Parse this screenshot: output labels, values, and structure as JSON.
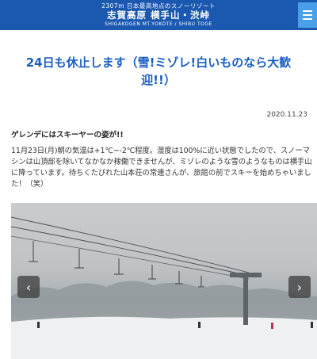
{
  "header": {
    "tagline": "2307m  日本最高地点のスノーリゾート",
    "brand": "志賀高原 横手山・渋峠",
    "brand_sub": "SHIGAKOGEN  MT.YOKOTE / SHIBU TOGE",
    "menu_icon": "hamburger-icon"
  },
  "post": {
    "title": "24日も休止します（雪!ミゾレ!白いものなら大歓迎!!）",
    "date": "2020.11.23",
    "lead": "ゲレンデにはスキーヤーの姿が!!",
    "body": "11月23日(月)朝の気温は+1℃~-2℃程度。湿度は100%に近い状態でしたので、スノーマシンは山頂部を除いてなかなか稼働できませんが、ミゾレのような雪のようなものは横手山に降っています。待ちくたびれた山本荘の常連さんが、旅館の前でスキーを始めちゃいました！（笑）"
  },
  "slider": {
    "prev_icon": "chevron-left-icon",
    "next_icon": "chevron-right-icon",
    "prev_glyph": "‹",
    "next_glyph": "›"
  },
  "colors": {
    "header_bg": "#1b59b1",
    "menu_bg": "#4aa0e8",
    "title": "#1b5fc2"
  }
}
